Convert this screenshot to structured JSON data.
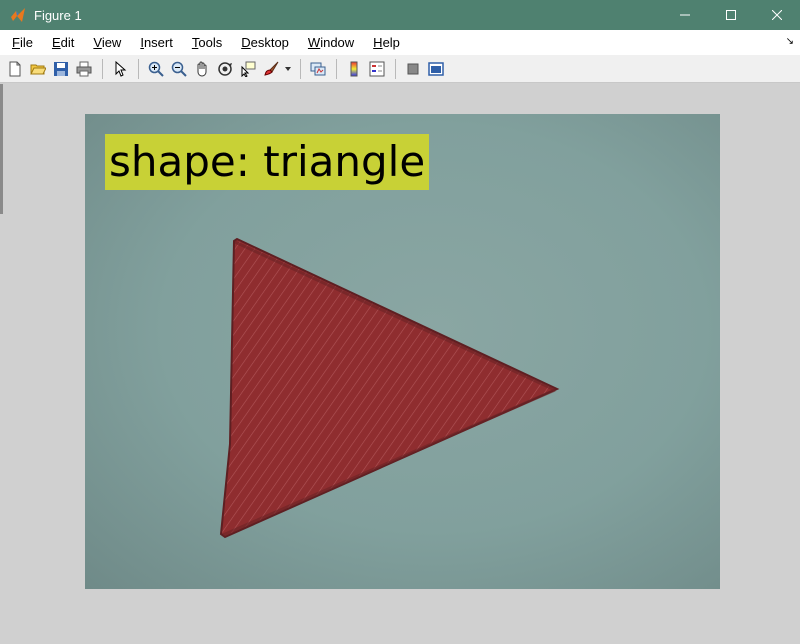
{
  "window": {
    "title": "Figure 1",
    "icon": "matlab-icon",
    "controls": [
      "minimize-icon",
      "maximize-icon",
      "close-icon"
    ]
  },
  "menu": {
    "items": [
      {
        "first": "F",
        "rest": "ile"
      },
      {
        "first": "E",
        "rest": "dit"
      },
      {
        "first": "V",
        "rest": "iew"
      },
      {
        "first": "I",
        "rest": "nsert"
      },
      {
        "first": "T",
        "rest": "ools"
      },
      {
        "first": "D",
        "rest": "esktop"
      },
      {
        "first": "W",
        "rest": "indow"
      },
      {
        "first": "H",
        "rest": "elp"
      }
    ],
    "overflow_icon": "chevron-icon"
  },
  "toolbar": {
    "icons": [
      "new-figure-icon",
      "open-file-icon",
      "save-icon",
      "print-icon",
      "select-arrow-icon",
      "zoom-in-icon",
      "zoom-out-icon",
      "pan-icon",
      "rotate-3d-icon",
      "data-cursor-icon",
      "brush-icon",
      "link-plot-icon",
      "colorbar-icon",
      "legend-icon",
      "hide-plot-tools-icon",
      "show-plot-tools-icon"
    ]
  },
  "figure": {
    "label": "shape: triangle",
    "label_bg": "#c8d136",
    "shape_color": "#8f2d2f"
  }
}
